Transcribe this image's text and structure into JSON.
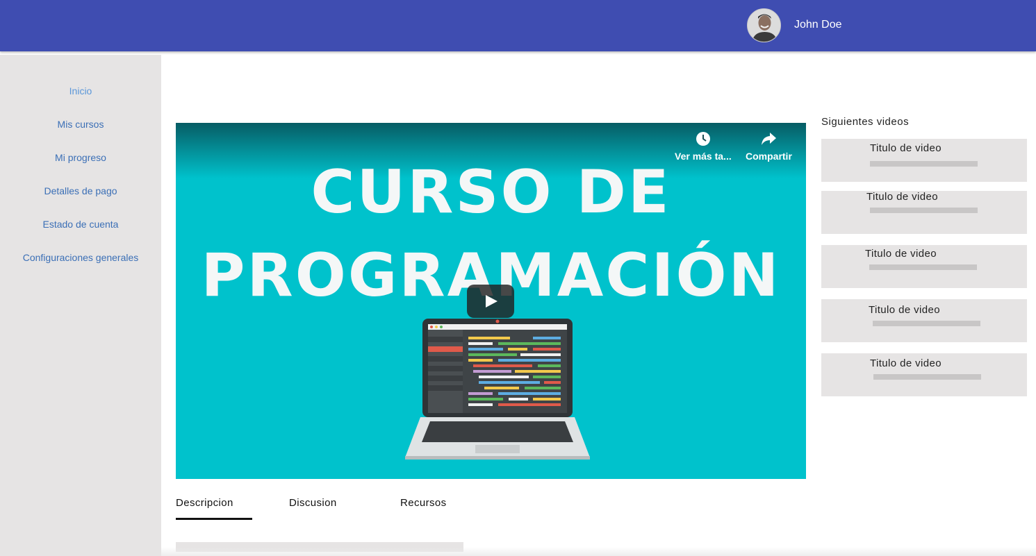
{
  "header": {
    "user_name": "John Doe",
    "avatar_icon": "user-avatar"
  },
  "sidebar": {
    "items": [
      {
        "label": "Inicio",
        "active": true
      },
      {
        "label": "Mis cursos",
        "active": false
      },
      {
        "label": "Mi progreso",
        "active": false
      },
      {
        "label": "Detalles de pago",
        "active": false
      },
      {
        "label": "Estado de cuenta",
        "active": false
      },
      {
        "label": "Configuraciones generales",
        "active": false
      }
    ]
  },
  "video": {
    "title_line1": "CURSO DE",
    "title_line2": "PROGRAMACIÓN",
    "watch_later_label": "Ver más ta...",
    "share_label": "Compartir",
    "background_color": "#00c2cc"
  },
  "next_videos": {
    "heading": "Siguientes videos",
    "items": [
      {
        "title": "Titulo de video"
      },
      {
        "title": "Titulo de video"
      },
      {
        "title": "Titulo de video"
      },
      {
        "title": "Titulo de video"
      },
      {
        "title": "Titulo de video"
      }
    ]
  },
  "tabs": [
    {
      "label": "Descripcion",
      "active": true
    },
    {
      "label": "Discusion",
      "active": false
    },
    {
      "label": "Recursos",
      "active": false
    }
  ],
  "colors": {
    "header": "#3f4db1",
    "sidebar": "#e6e4e4",
    "link": "#3b6fb6"
  }
}
